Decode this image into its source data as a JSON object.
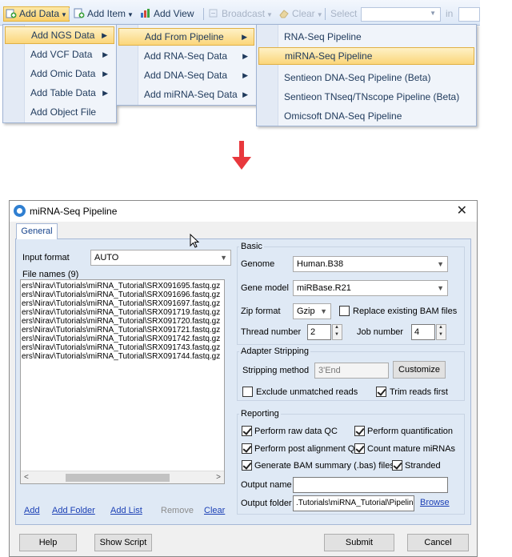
{
  "toolbar": {
    "add_data": "Add Data",
    "add_item": "Add Item",
    "add_view": "Add View",
    "broadcast": "Broadcast",
    "clear": "Clear",
    "select": "Select",
    "in": "in"
  },
  "menu1": {
    "items": [
      "Add NGS Data",
      "Add VCF Data",
      "Add Omic Data",
      "Add Table Data",
      "Add Object File"
    ]
  },
  "menu2": {
    "items": [
      "Add From Pipeline",
      "Add RNA-Seq Data",
      "Add DNA-Seq Data",
      "Add miRNA-Seq Data"
    ]
  },
  "menu3": {
    "items": [
      "RNA-Seq Pipeline",
      "miRNA-Seq Pipeline",
      "Sentieon DNA-Seq Pipeline (Beta)",
      "Sentieon TNseq/TNscope Pipeline (Beta)",
      "Omicsoft DNA-Seq Pipeline"
    ]
  },
  "dialog": {
    "title": "miRNA-Seq Pipeline",
    "tab": "General",
    "input_format_label": "Input format",
    "input_format_value": "AUTO",
    "file_names_label": "File names (9)",
    "files": [
      "ers\\Nirav\\Tutorials\\miRNA_Tutorial\\SRX091695.fastq.gz",
      "ers\\Nirav\\Tutorials\\miRNA_Tutorial\\SRX091696.fastq.gz",
      "ers\\Nirav\\Tutorials\\miRNA_Tutorial\\SRX091697.fastq.gz",
      "ers\\Nirav\\Tutorials\\miRNA_Tutorial\\SRX091719.fastq.gz",
      "ers\\Nirav\\Tutorials\\miRNA_Tutorial\\SRX091720.fastq.gz",
      "ers\\Nirav\\Tutorials\\miRNA_Tutorial\\SRX091721.fastq.gz",
      "ers\\Nirav\\Tutorials\\miRNA_Tutorial\\SRX091742.fastq.gz",
      "ers\\Nirav\\Tutorials\\miRNA_Tutorial\\SRX091743.fastq.gz",
      "ers\\Nirav\\Tutorials\\miRNA_Tutorial\\SRX091744.fastq.gz"
    ],
    "links": {
      "add": "Add",
      "add_folder": "Add Folder",
      "add_list": "Add List",
      "remove": "Remove",
      "clear": "Clear"
    },
    "basic": {
      "title": "Basic",
      "genome_label": "Genome",
      "genome_value": "Human.B38",
      "gene_model_label": "Gene model",
      "gene_model_value": "miRBase.R21",
      "zip_format_label": "Zip format",
      "zip_format_value": "Gzip",
      "replace_bam_label": "Replace existing BAM files",
      "thread_number_label": "Thread number",
      "thread_number_value": "2",
      "job_number_label": "Job number",
      "job_number_value": "4"
    },
    "adapter": {
      "title": "Adapter Stripping",
      "method_label": "Stripping method",
      "method_value": "3'End",
      "customize": "Customize",
      "exclude_label": "Exclude unmatched reads",
      "trim_label": "Trim reads first"
    },
    "reporting": {
      "title": "Reporting",
      "raw_qc": "Perform raw data QC",
      "quantification": "Perform quantification",
      "post_qc": "Perform post alignment QC",
      "count_mature": "Count mature miRNAs",
      "bam_summary": "Generate BAM summary (.bas) files",
      "stranded": "Stranded",
      "output_name_label": "Output name",
      "output_name_value": "",
      "output_folder_label": "Output folder",
      "output_folder_value": ".Tutorials\\miRNA_Tutorial\\Pipeline",
      "browse": "Browse"
    },
    "buttons": {
      "help": "Help",
      "show_script": "Show Script",
      "submit": "Submit",
      "cancel": "Cancel"
    }
  },
  "colors": {
    "accent_arrow": "#e8383d",
    "menu_highlight": "#fbd67a",
    "link": "#1a3fb5"
  }
}
